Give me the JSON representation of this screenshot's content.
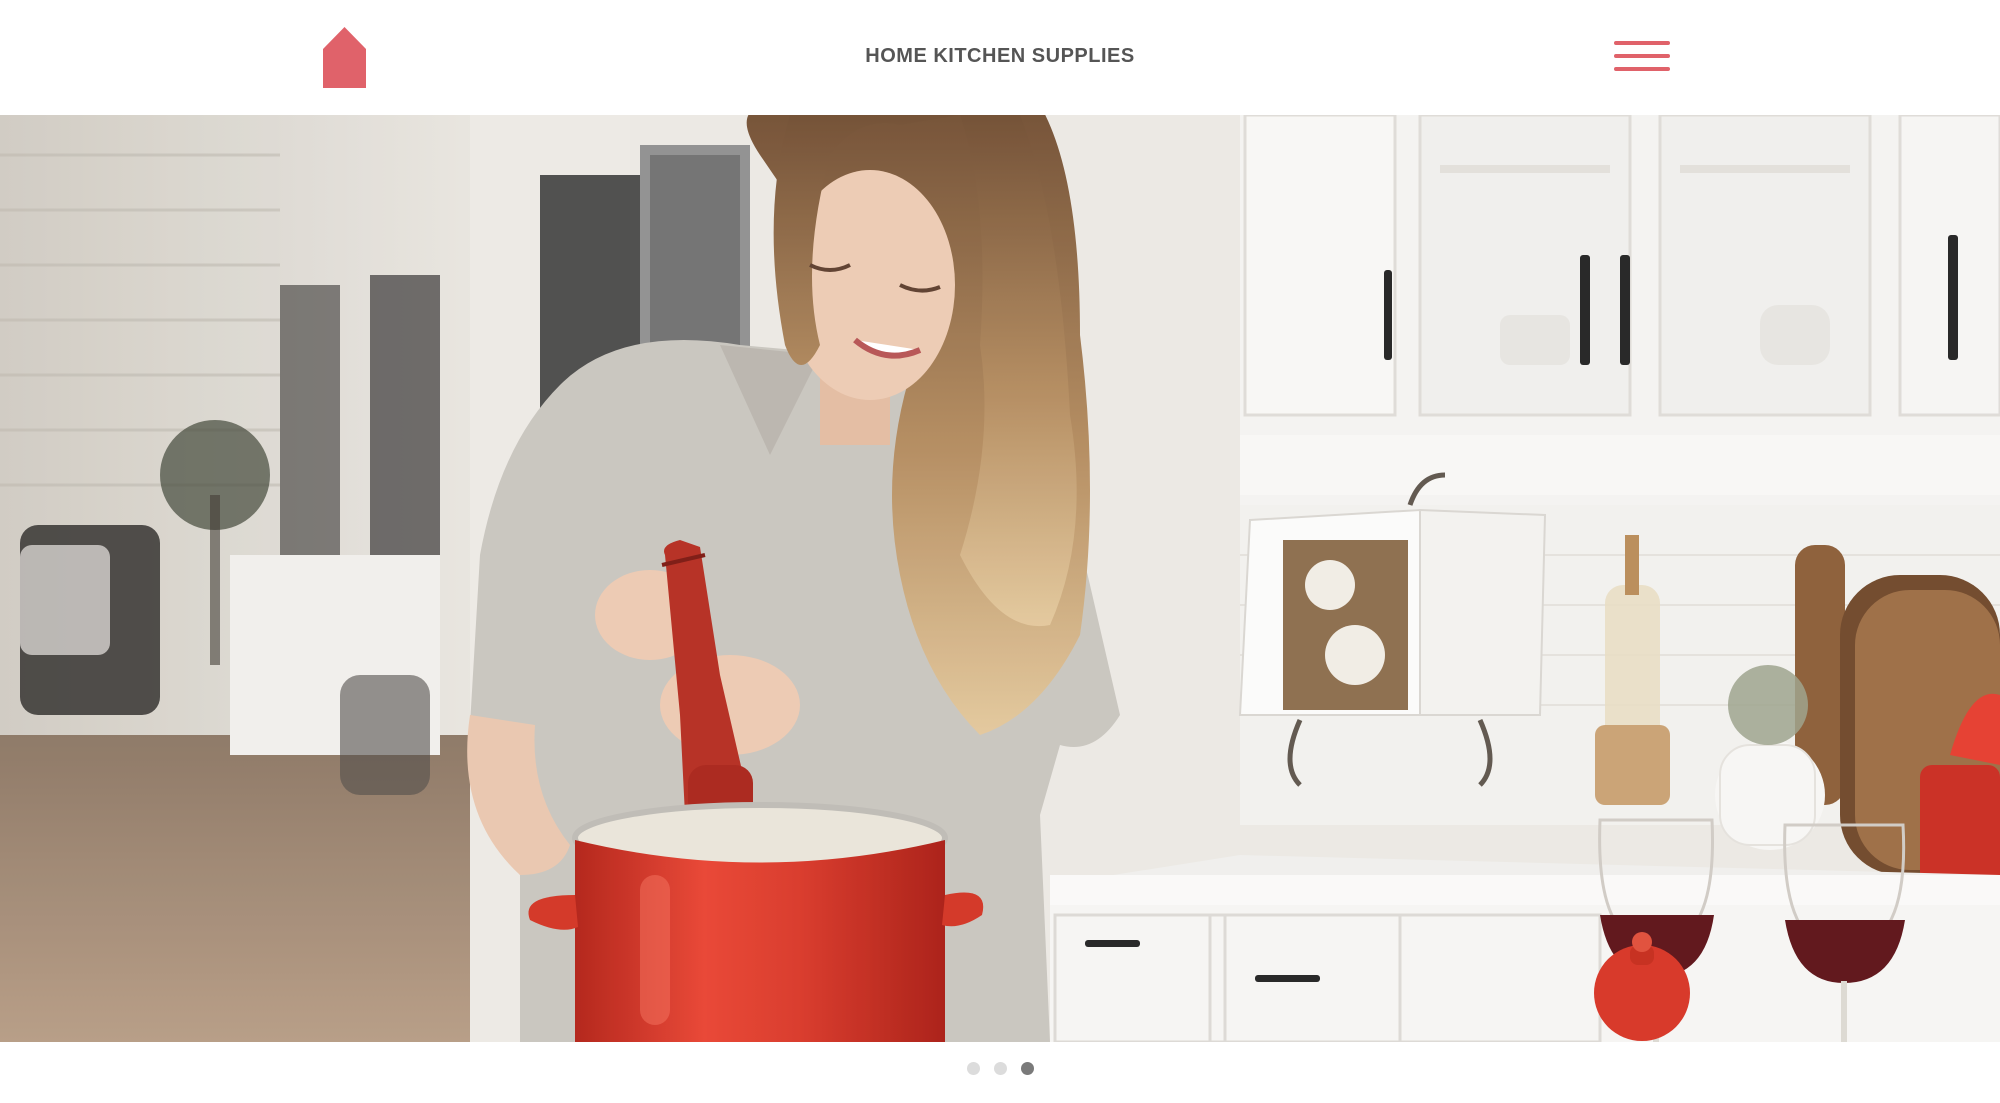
{
  "header": {
    "title": "HOME KITCHEN SUPPLIES",
    "logo_icon": "house-icon",
    "menu_icon": "hamburger-menu-icon"
  },
  "colors": {
    "brand": "#e0626a",
    "title_text": "#555555",
    "dot_inactive": "#dcdcdc",
    "dot_active": "#7a7a7a"
  },
  "hero": {
    "image": "woman-grinding-pepper-into-red-pot-photo"
  },
  "carousel": {
    "slide_count": 3,
    "active_index": 2
  }
}
